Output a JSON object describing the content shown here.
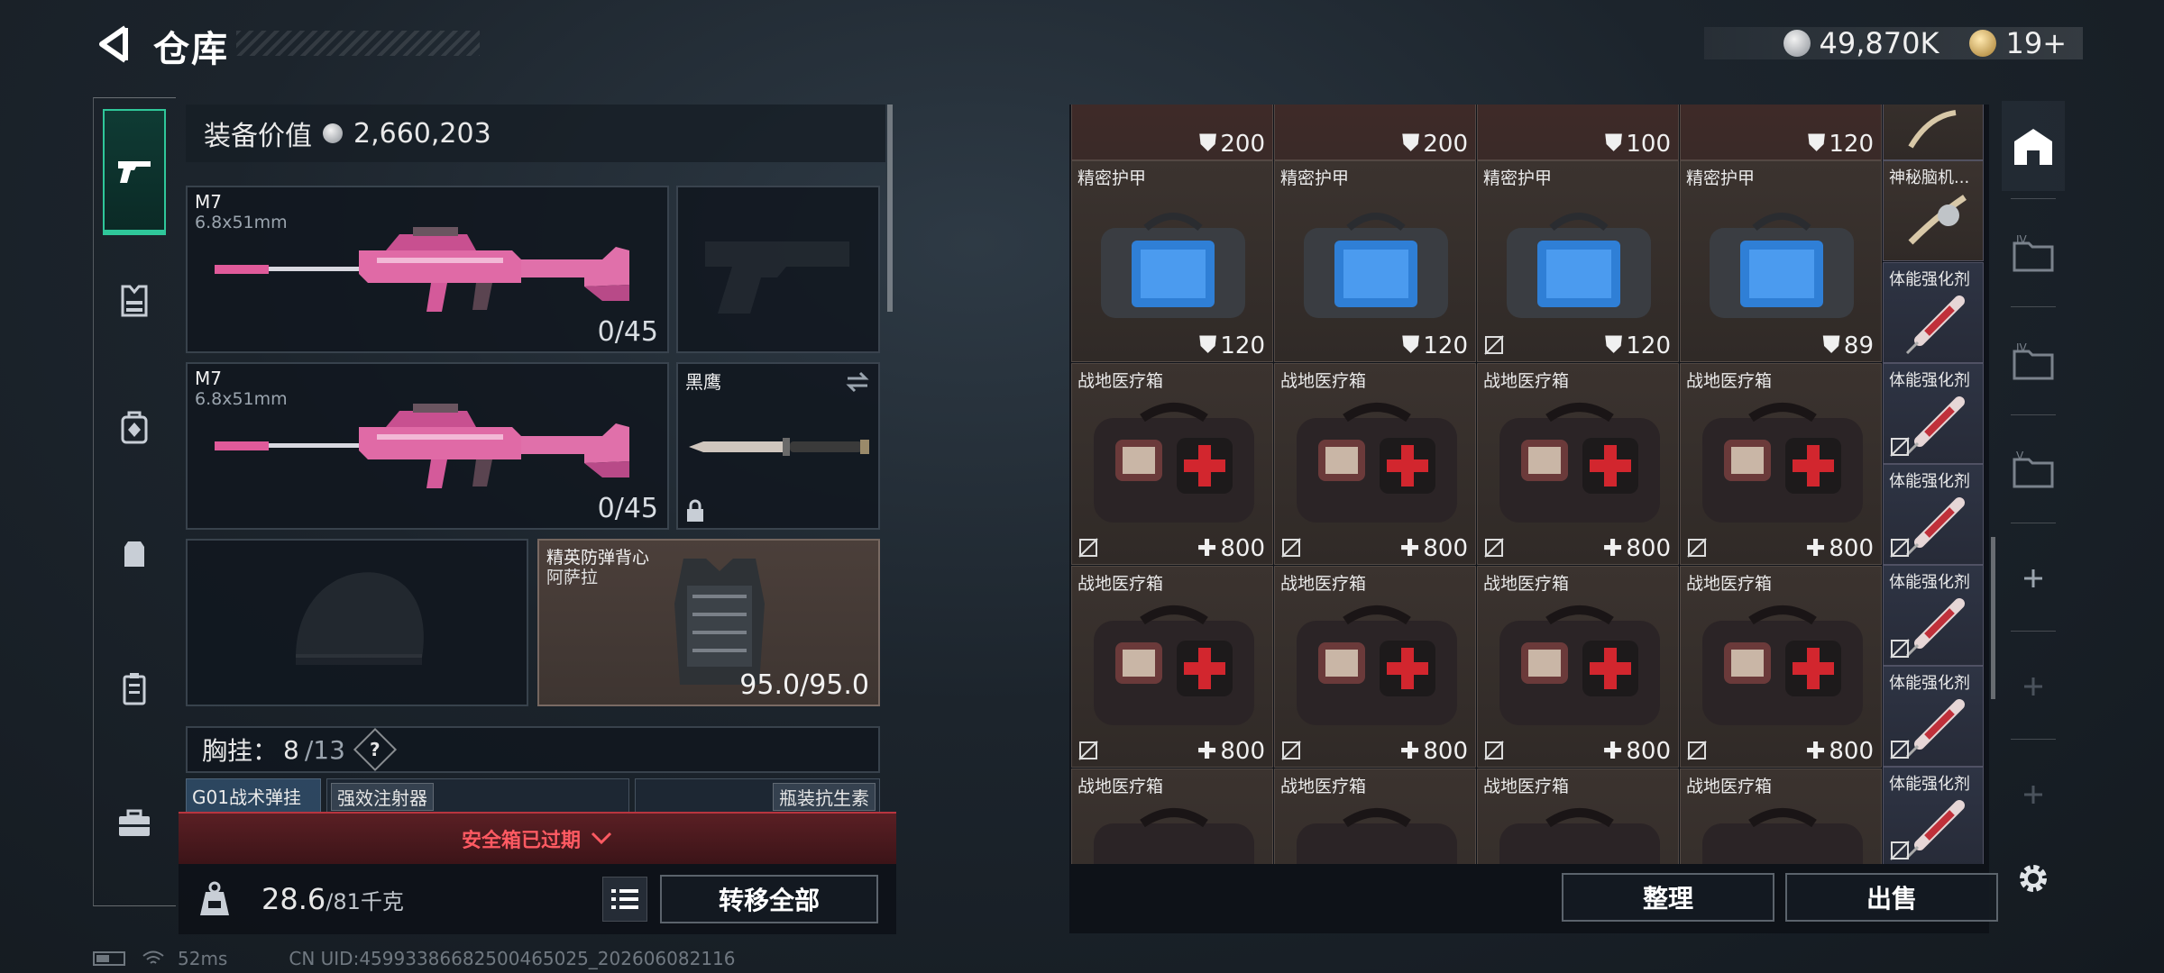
{
  "header": {
    "title": "仓库",
    "currency_main": "49,870K",
    "currency_premium": "19+"
  },
  "equipment": {
    "value_label": "装备价值",
    "value": "2,660,203",
    "primary1": {
      "name": "M7",
      "caliber": "6.8x51mm",
      "ammo": "0/45"
    },
    "primary2": {
      "name": "M7",
      "caliber": "6.8x51mm",
      "ammo": "0/45"
    },
    "melee": {
      "name": "黑鹰"
    },
    "armor": {
      "name": "精英防弹背心",
      "sub": "阿萨拉",
      "durability": "95.0/95.0"
    },
    "rig": {
      "label": "胸挂：",
      "used": "8",
      "total": "/13",
      "help": "?"
    },
    "rig_items": [
      "G01战术弹挂",
      "强效注射器",
      "瓶装抗生素"
    ],
    "safe_banner": "安全箱已过期",
    "weight": {
      "current": "28.6",
      "max": "/81",
      "unit": "千克"
    },
    "transfer_all": "转移全部"
  },
  "stash": {
    "top_row_values": [
      "200",
      "200",
      "100",
      "120"
    ],
    "armor_row": [
      {
        "name": "精密护甲",
        "value": "120",
        "no_trade": false
      },
      {
        "name": "精密护甲",
        "value": "120",
        "no_trade": false
      },
      {
        "name": "精密护甲",
        "value": "120",
        "no_trade": true
      },
      {
        "name": "精密护甲",
        "value": "89",
        "no_trade": false
      }
    ],
    "medkit_row1": [
      {
        "name": "战地医疗箱",
        "value": "800"
      },
      {
        "name": "战地医疗箱",
        "value": "800"
      },
      {
        "name": "战地医疗箱",
        "value": "800"
      },
      {
        "name": "战地医疗箱",
        "value": "800"
      }
    ],
    "medkit_row2": [
      {
        "name": "战地医疗箱",
        "value": "800"
      },
      {
        "name": "战地医疗箱",
        "value": "800"
      },
      {
        "name": "战地医疗箱",
        "value": "800"
      },
      {
        "name": "战地医疗箱",
        "value": "800"
      }
    ],
    "medkit_row3": [
      {
        "name": "战地医疗箱"
      },
      {
        "name": "战地医疗箱"
      },
      {
        "name": "战地医疗箱"
      },
      {
        "name": "战地医疗箱"
      }
    ],
    "side_column": [
      {
        "name": "神秘脑机..."
      },
      {
        "name": "体能强化剂"
      },
      {
        "name": "体能强化剂"
      },
      {
        "name": "体能强化剂"
      },
      {
        "name": "体能强化剂"
      },
      {
        "name": "体能强化剂"
      },
      {
        "name": "体能强化剂"
      }
    ],
    "sort_label": "整理",
    "sell_label": "出售"
  },
  "status": {
    "ping": "52ms",
    "uid": "CN UID:4599338668250046502​5_202606082116"
  },
  "colors": {
    "accent": "#2fc79a",
    "danger": "#ff5a62"
  }
}
